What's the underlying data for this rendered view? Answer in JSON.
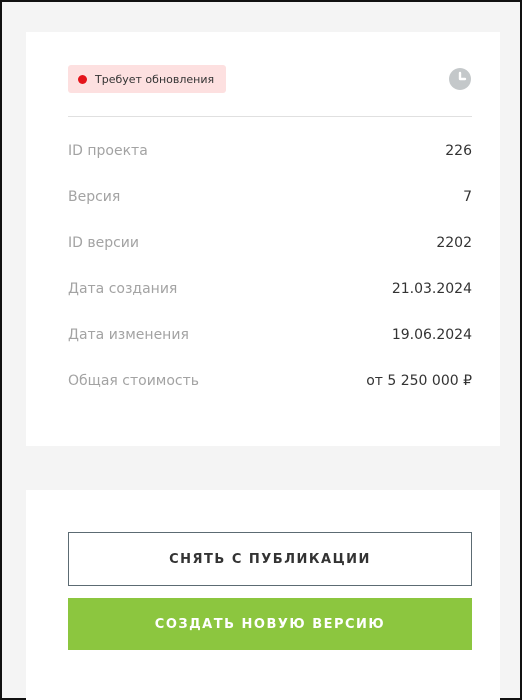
{
  "status": {
    "badge_label": "Требует обновления",
    "badge_color": "#e4141b",
    "history_icon": "clock-icon"
  },
  "details": [
    {
      "label": "ID проекта",
      "value": "226"
    },
    {
      "label": "Версия",
      "value": "7"
    },
    {
      "label": "ID версии",
      "value": "2202"
    },
    {
      "label": "Дата создания",
      "value": "21.03.2024"
    },
    {
      "label": "Дата изменения",
      "value": "19.06.2024"
    },
    {
      "label": "Общая стоимость",
      "value": "от 5 250 000 ₽"
    }
  ],
  "actions": {
    "unpublish_label": "СНЯТЬ С ПУБЛИКАЦИИ",
    "new_version_label": "СОЗДАТЬ НОВУЮ ВЕРСИЮ",
    "primary_color": "#8cc63f"
  }
}
